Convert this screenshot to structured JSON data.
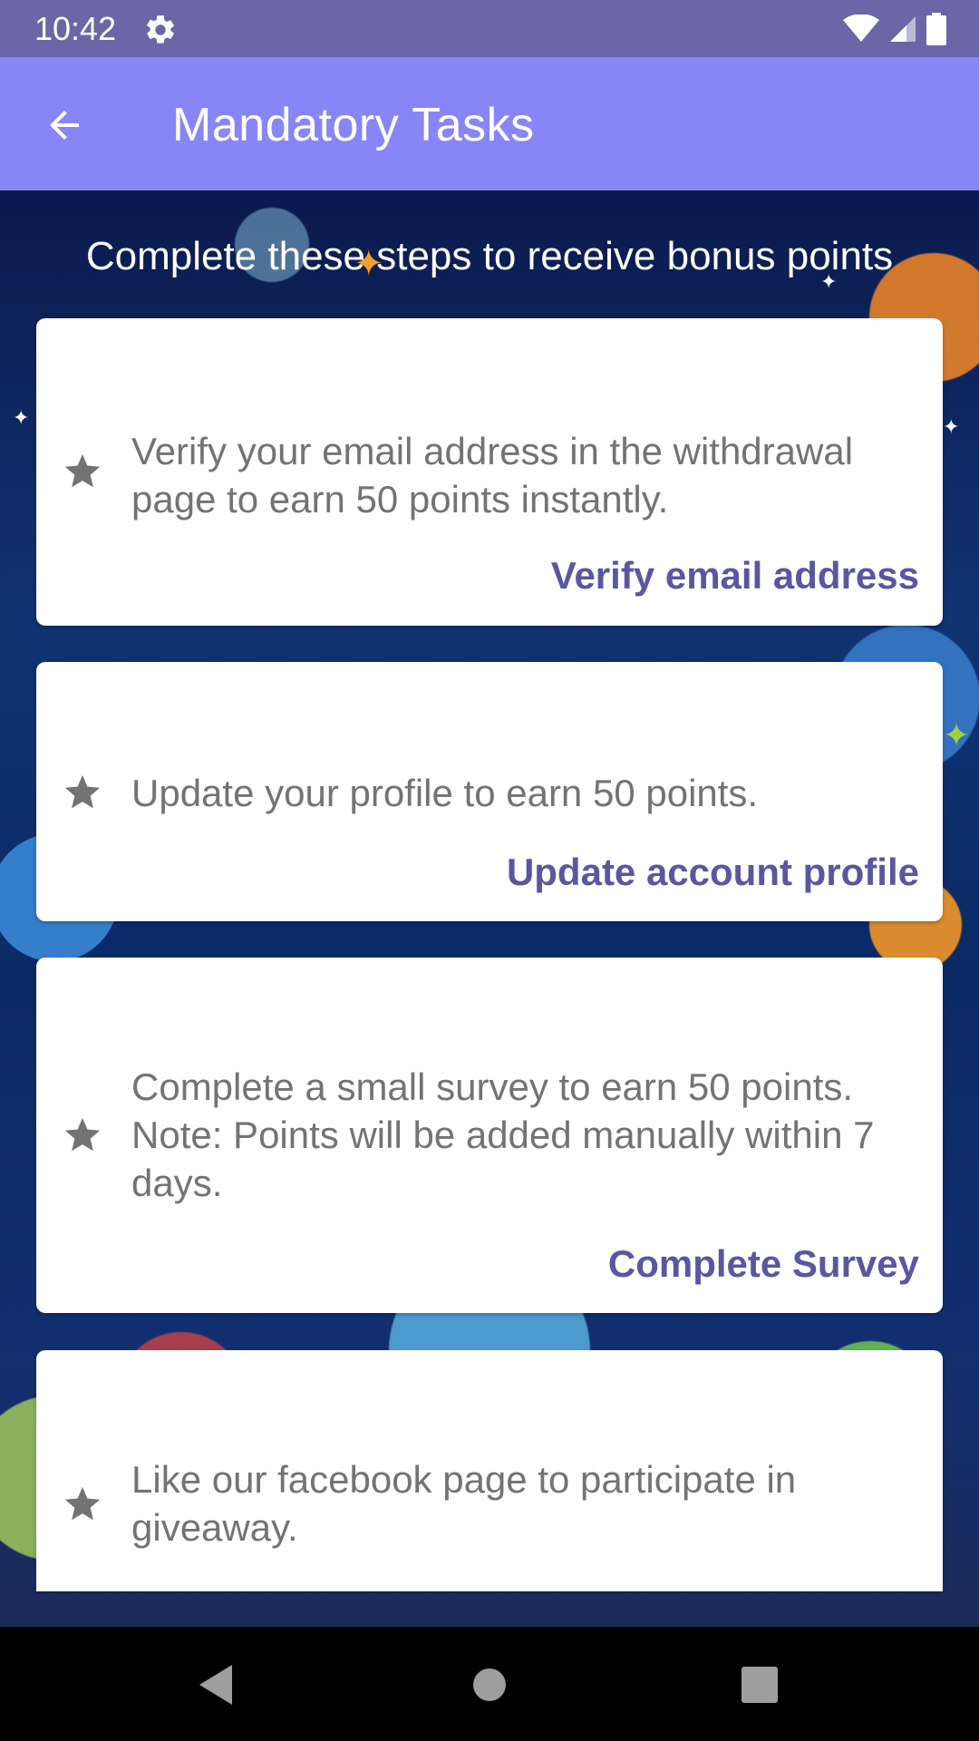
{
  "status_bar": {
    "time": "10:42",
    "icons": [
      "settings-icon",
      "wifi-icon",
      "signal-icon",
      "battery-icon"
    ]
  },
  "app_bar": {
    "title": "Mandatory Tasks",
    "back_icon": "arrow-back-icon",
    "background": "#8886f7"
  },
  "subtitle": "Complete these steps to receive bonus points",
  "tasks": [
    {
      "description": "Verify your email address in the withdrawal page to earn 50 points instantly.",
      "action": "Verify email address",
      "icon": "star-icon"
    },
    {
      "description": "Update your profile to earn 50 points.",
      "action": "Update account profile",
      "icon": "star-icon"
    },
    {
      "description_lines": [
        "Complete a small survey to earn 50 points.",
        "Note: Points will be added manually within 7",
        "days."
      ],
      "action": "Complete Survey",
      "icon": "star-icon"
    },
    {
      "description": "Like our facebook page to participate in giveaway.",
      "icon": "star-icon"
    }
  ],
  "nav_bar": {
    "buttons": [
      "back-triangle-icon",
      "home-circle-icon",
      "recents-square-icon"
    ]
  },
  "colors": {
    "status_bar": "#6a66a7",
    "app_bar": "#8886f7",
    "action_text": "#5a56a0",
    "body_text": "#737373",
    "star": "#737373"
  }
}
